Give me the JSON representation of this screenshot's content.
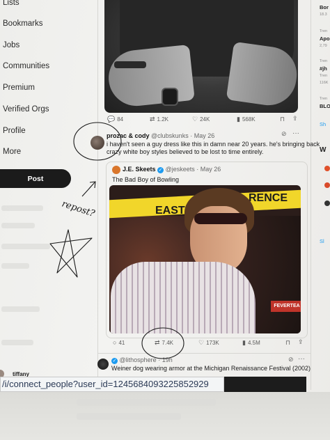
{
  "sidebar": {
    "items": [
      {
        "label": "Lists"
      },
      {
        "label": "Bookmarks"
      },
      {
        "label": "Jobs"
      },
      {
        "label": "Communities"
      },
      {
        "label": "Premium"
      },
      {
        "label": "Verified Orgs"
      },
      {
        "label": "Profile"
      },
      {
        "label": "More"
      }
    ],
    "post_label": "Post",
    "account_name": "tiffany"
  },
  "tweet1_actions": {
    "replies": "84",
    "reposts": "1.2K",
    "likes": "24K",
    "views": "568K"
  },
  "quote_tweet": {
    "name": "prozac & cody",
    "handle": "@clubskunks",
    "date": "· May 26",
    "line1": "i haven't seen a guy dress like this in damn near 20 years. he's bringing back",
    "line2": "crazy white boy styles believed to be lost to time entirely."
  },
  "quoted_tweet": {
    "name": "J.E. Skeets",
    "handle": "@jeskeets",
    "date": "· May 26",
    "text": "The Bad Boy of Bowling",
    "image_text": {
      "east": "EAST",
      "rence": "RENCE",
      "sign": "FEVERTEA"
    }
  },
  "tweet2_actions": {
    "replies": "41",
    "reposts": "7.4K",
    "likes": "173K",
    "views": "4.5M"
  },
  "next_tweet": {
    "handle": "@lithosphere",
    "time": "· 19h",
    "text": "Weiner dog wearing armor at the Michigan Renaissance Festival (2002)"
  },
  "right_column": {
    "lines": [
      {
        "text": "Bor",
        "style": "bold"
      },
      {
        "text": "18.3",
        "style": "small"
      },
      {
        "text": "Tren",
        "style": "small"
      },
      {
        "text": "Apo",
        "style": "bold"
      },
      {
        "text": "2,79",
        "style": "small"
      },
      {
        "text": "Tren",
        "style": "small"
      },
      {
        "text": "#jh",
        "style": "bold"
      },
      {
        "text": "Tren",
        "style": "small"
      },
      {
        "text": "116K",
        "style": "small"
      },
      {
        "text": "Tren",
        "style": "small"
      },
      {
        "text": "BLO",
        "style": "bold"
      },
      {
        "text": "Sh",
        "style": "blue"
      },
      {
        "text": "W",
        "style": "bold"
      },
      {
        "text": "Sl",
        "style": "blue"
      }
    ]
  },
  "url_bar": {
    "url": "/i/connect_people?user_id=1245684093225852929"
  },
  "annotations": {
    "note": "repost?"
  },
  "colors": {
    "accent": "#1d9bf0",
    "post_button": "#1b1b1b"
  }
}
